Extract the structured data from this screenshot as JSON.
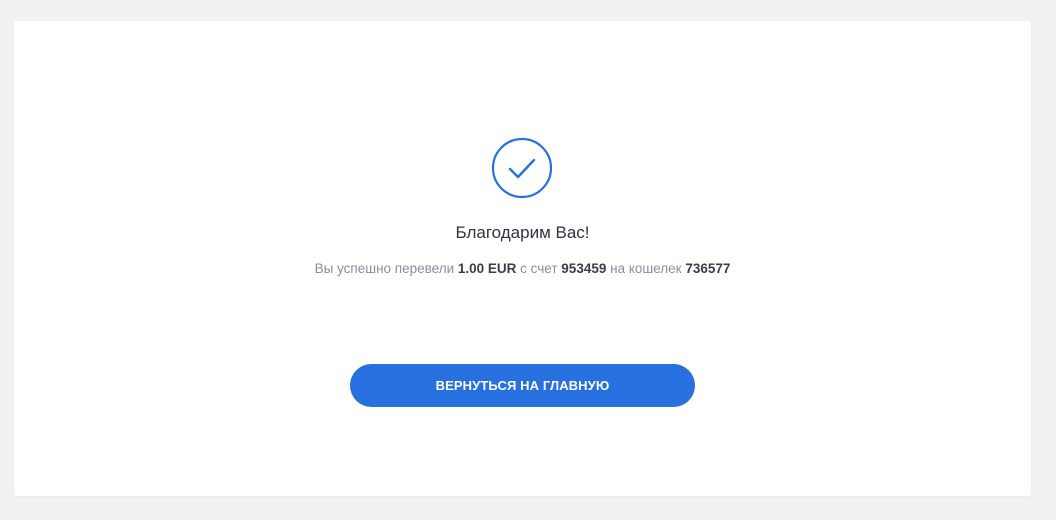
{
  "success": {
    "icon": "check-circle-icon",
    "title": "Благодарим Вас!",
    "message": {
      "part1": "Вы успешно перевели ",
      "amount": "1.00 EUR",
      "part2": " с счет ",
      "account": "953459",
      "part3": " на кошелек ",
      "wallet": "736577"
    },
    "button_label": "ВЕРНУТЬСЯ НА ГЛАВНУЮ"
  },
  "colors": {
    "accent": "#2770df",
    "background": "#f0f1f3",
    "card": "#ffffff"
  }
}
